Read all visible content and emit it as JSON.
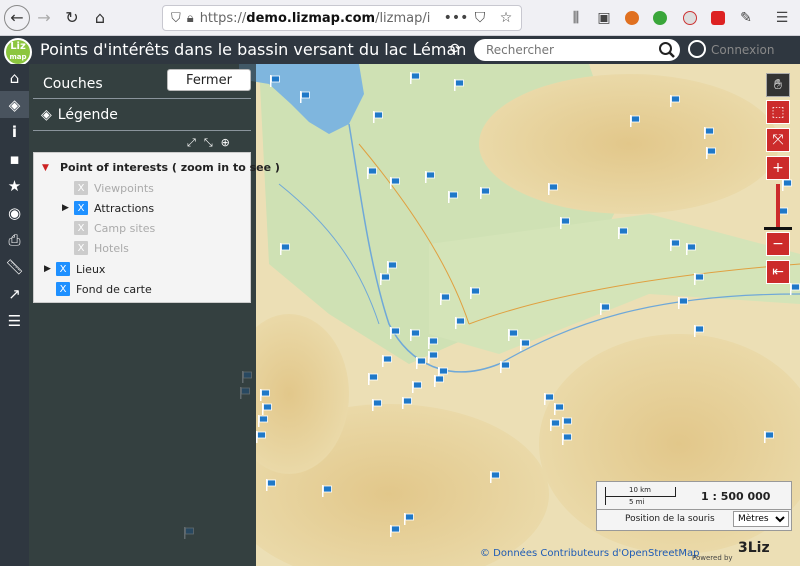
{
  "browser": {
    "url_protocol": "https://",
    "url_host": "demo.lizmap.com",
    "url_path": "/lizmap/i"
  },
  "app": {
    "logo_line1": "Liz",
    "logo_line2": "map",
    "title": "Points d'intérêts dans le bassin versant du lac Léman",
    "search_placeholder": "Rechercher",
    "login_label": "Connexion"
  },
  "panel": {
    "title": "Couches",
    "close_label": "Fermer",
    "legend_label": "Légende"
  },
  "layers": [
    {
      "label": "Point of interests ( zoom in to see )",
      "checkbox": "",
      "disabled": false,
      "group": true
    },
    {
      "label": "Viewpoints",
      "checkbox": "X",
      "disabled": true
    },
    {
      "label": "Attractions",
      "checkbox": "X",
      "disabled": false
    },
    {
      "label": "Camp sites",
      "checkbox": "X",
      "disabled": true
    },
    {
      "label": "Hotels",
      "checkbox": "X",
      "disabled": true
    },
    {
      "label": "Lieux",
      "checkbox": "X",
      "disabled": false
    },
    {
      "label": "Fond de carte",
      "checkbox": "X",
      "disabled": false
    }
  ],
  "scale": {
    "km_label": "10 km",
    "mi_label": "5 mi",
    "ratio": "1 : 500 000",
    "mouse_position_label": "Position de la souris",
    "units_value": "Mètres"
  },
  "map": {
    "attribution": "© Données Contributeurs d'OpenStreetMap",
    "powered_by": "Powered by",
    "brand": "3Liz"
  },
  "colors": {
    "header_bg": "#2f3740",
    "accent_red": "#cc2b2b",
    "checkbox_blue": "#1e90ff",
    "lake_blue": "#7fb6de",
    "marker_blue": "#1f78c8"
  }
}
